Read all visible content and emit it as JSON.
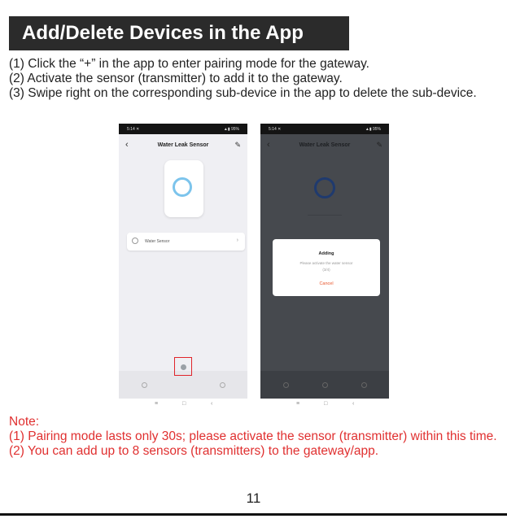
{
  "title": "Add/Delete Devices in the App",
  "steps": [
    "(1) Click the “+” in the app to enter pairing mode for the gateway.",
    "(2) Activate the sensor (transmitter) to add it to the gateway.",
    "(3) Swipe right on the corresponding sub-device in the app to delete the sub-device."
  ],
  "screen_left": {
    "status_left": "5:14 ✕",
    "status_right": "▲▮ 95%",
    "back_icon": "back-arrow-icon",
    "app_title": "Water Leak Sensor",
    "edit_icon": "pencil-icon",
    "sub_device_label": "Water Sensor",
    "sub_device_chevron": "›"
  },
  "screen_right": {
    "status_left": "5:14 ✕",
    "status_right": "▲▮ 95%",
    "app_title": "Water Leak Sensor",
    "dialog_title": "Adding",
    "dialog_message_line1": "Please activate the water sensor",
    "dialog_message_line2": "(3/4)",
    "dialog_cancel": "Cancel"
  },
  "system_keys": {
    "menu": "≡",
    "home": "□",
    "back": "‹"
  },
  "note_heading": "Note:",
  "notes": [
    "(1) Pairing mode lasts only 30s; please activate the sensor (transmitter) within this time.",
    "(2) You can add up to 8 sensors (transmitters) to the gateway/app."
  ],
  "page_number": "11",
  "colors": {
    "title_bg": "#2b2b2b",
    "note_text": "#e03030",
    "highlight_box": "#e0242a",
    "ring": "#7cc4ec",
    "cancel": "#e8562c"
  }
}
